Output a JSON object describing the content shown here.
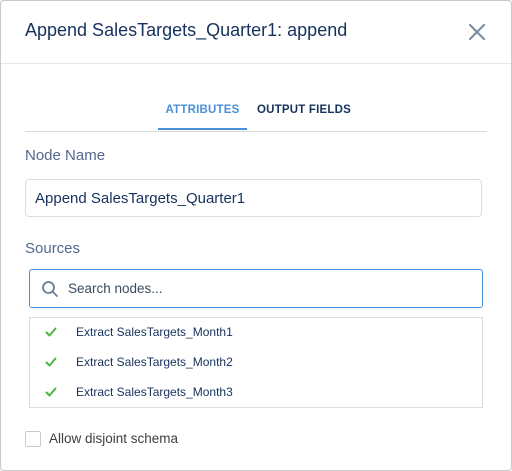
{
  "dialog": {
    "title": "Append SalesTargets_Quarter1: append"
  },
  "tabs": [
    {
      "label": "ATTRIBUTES",
      "active": true
    },
    {
      "label": "OUTPUT FIELDS",
      "active": false
    }
  ],
  "node_name": {
    "label": "Node Name",
    "value": "Append SalesTargets_Quarter1"
  },
  "sources": {
    "label": "Sources",
    "search_placeholder": "Search nodes...",
    "items": [
      {
        "label": "Extract SalesTargets_Month1",
        "icon": "check-icon"
      },
      {
        "label": "Extract SalesTargets_Month2",
        "icon": "check-icon"
      },
      {
        "label": "Extract SalesTargets_Month3",
        "icon": "check-icon"
      }
    ]
  },
  "options": {
    "allow_disjoint_label": "Allow disjoint schema",
    "allow_disjoint_checked": false
  },
  "colors": {
    "accent": "#4a90d9",
    "check": "#4bb543",
    "title": "#16325c"
  }
}
